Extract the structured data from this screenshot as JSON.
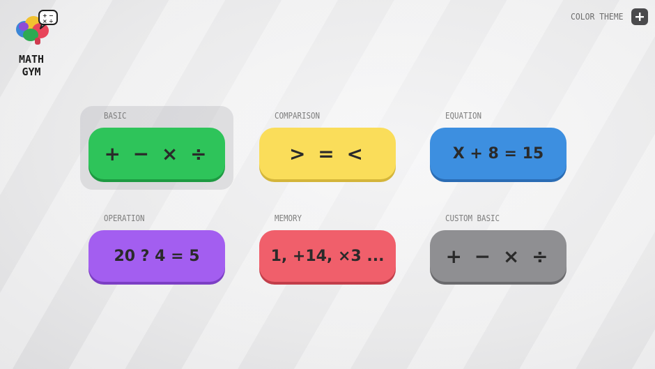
{
  "logo": {
    "line1": "MATH",
    "line2": "GYM"
  },
  "theme": {
    "label": "COLOR THEME",
    "button_icon": "plus-icon"
  },
  "modes": [
    {
      "id": "basic",
      "label": "BASIC",
      "display": "+ − × ÷",
      "color": "#2ec45a",
      "shadow": "#1d9a41"
    },
    {
      "id": "comparison",
      "label": "COMPARISON",
      "display": "> = <",
      "color": "#fadd5a",
      "shadow": "#d4b53a"
    },
    {
      "id": "equation",
      "label": "EQUATION",
      "display": "X + 8 = 15",
      "color": "#3d8fe0",
      "shadow": "#2a6cb4"
    },
    {
      "id": "operation",
      "label": "OPERATION",
      "display": "20 ? 4 = 5",
      "color": "#a35ef0",
      "shadow": "#7c3fc4"
    },
    {
      "id": "memory",
      "label": "MEMORY",
      "display": "1, +14, ×3 ...",
      "color": "#f05f6b",
      "shadow": "#c23e4a"
    },
    {
      "id": "custom_basic",
      "label": "CUSTOM BASIC",
      "display": "+ − × ÷",
      "color": "#8f8f92",
      "shadow": "#6a6a6d"
    }
  ],
  "selected_mode": "basic"
}
